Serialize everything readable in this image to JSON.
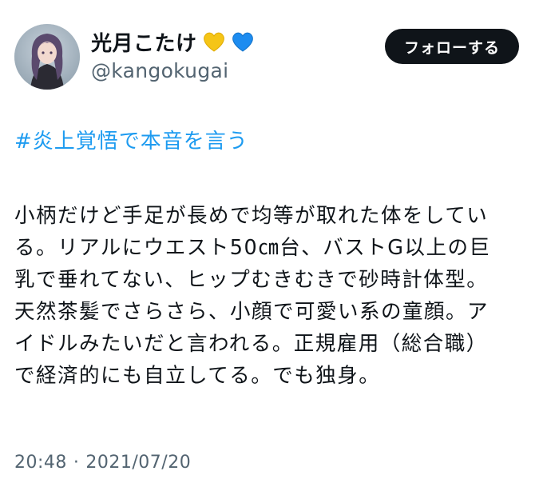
{
  "user": {
    "display_name": "光月こたけ",
    "handle": "@kangokugai",
    "heart_icons": [
      "yellow-heart-icon",
      "blue-heart-icon"
    ],
    "heart_colors": [
      "#f5c517",
      "#1d8cf0"
    ]
  },
  "follow_button": {
    "label": "フォローする"
  },
  "tweet": {
    "hashtag": "#炎上覚悟で本音を言う",
    "lines": [
      "小柄だけど手足が長めで均等が取れた体をしてい",
      "る。リアルにウエスト50㎝台、バストG以上の巨",
      "乳で垂れてない、ヒップむきむきで砂時計体型。",
      "天然茶髪でさらさら、小顔で可愛い系の童顔。ア",
      "イドルみたいだと言われる。正規雇用（総合職）",
      "で経済的にも自立してる。でも独身。"
    ]
  },
  "meta": {
    "time": "20:48",
    "separator": "·",
    "date": "2021/07/20"
  },
  "colors": {
    "link": "#1d9bf0",
    "secondary_text": "#536471",
    "button_bg": "#0f1419"
  }
}
